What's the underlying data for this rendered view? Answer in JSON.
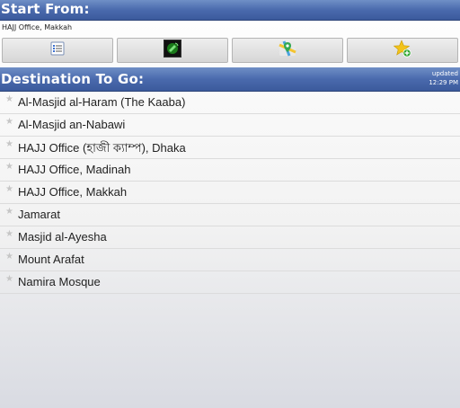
{
  "start": {
    "title": "Start From:",
    "value": "HAJJ Office, Makkah"
  },
  "toolbar": {
    "buttons": [
      {
        "icon": "list-icon"
      },
      {
        "icon": "gps-icon"
      },
      {
        "icon": "map-icon"
      },
      {
        "icon": "add-favorite-icon"
      }
    ]
  },
  "destination": {
    "title": "Destination To Go:",
    "updated_label": "updated",
    "updated_time": "12:29 PM",
    "items": [
      {
        "label": "Al-Masjid al-Haram (The Kaaba)"
      },
      {
        "label": "Al-Masjid an-Nabawi"
      },
      {
        "label": "HAJJ Office (হাজী ক্যাম্প), Dhaka"
      },
      {
        "label": "HAJJ Office, Madinah"
      },
      {
        "label": "HAJJ Office, Makkah"
      },
      {
        "label": "Jamarat"
      },
      {
        "label": "Masjid al-Ayesha"
      },
      {
        "label": "Mount Arafat"
      },
      {
        "label": "Namira Mosque"
      }
    ]
  },
  "colors": {
    "header_blue": "#4a6aad",
    "star_gray": "#c6c6c6"
  }
}
